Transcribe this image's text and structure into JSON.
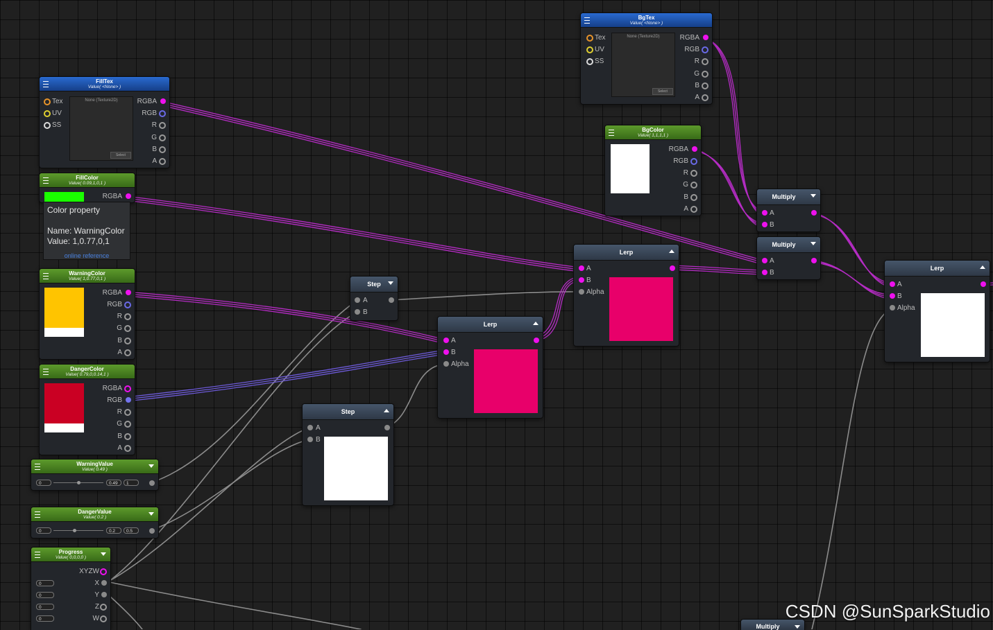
{
  "nodes": {
    "bgtex": {
      "title": "BgTex",
      "subtitle": "Value( <None> )",
      "inputs": [
        "Tex",
        "UV",
        "SS"
      ],
      "outputs": [
        "RGBA",
        "RGB",
        "R",
        "G",
        "B",
        "A"
      ],
      "texture_label": "None (Texture2D)",
      "select_label": "Select"
    },
    "filltex": {
      "title": "FillTex",
      "subtitle": "Value( <None> )",
      "inputs": [
        "Tex",
        "UV",
        "SS"
      ],
      "outputs": [
        "RGBA",
        "RGB",
        "R",
        "G",
        "B",
        "A"
      ],
      "texture_label": "None (Texture2D)",
      "select_label": "Select"
    },
    "bgcolor": {
      "title": "BgColor",
      "subtitle": "Value( 1,1,1,1 )",
      "outputs": [
        "RGBA",
        "RGB",
        "R",
        "G",
        "B",
        "A"
      ],
      "swatch_color": "#ffffff"
    },
    "fillcolor": {
      "title": "FillColor",
      "subtitle": "Value( 0.09,1,0,1 )",
      "outputs": [
        "RGBA"
      ],
      "swatch_color": "#1aff00"
    },
    "warningcolor": {
      "title": "WarningColor",
      "subtitle": "Value( 1,0.77,0,1 )",
      "outputs": [
        "RGBA",
        "RGB",
        "R",
        "G",
        "B",
        "A"
      ],
      "swatch_color": "#ffc400"
    },
    "dangercolor": {
      "title": "DangerColor",
      "subtitle": "Value( 0.79,0,0.14,1 )",
      "outputs": [
        "RGBA",
        "RGB",
        "R",
        "G",
        "B",
        "A"
      ],
      "swatch_color": "#ca0023"
    },
    "warningvalue": {
      "title": "WarningValue",
      "subtitle": "Value( 0.49 )",
      "min": "0",
      "value": "0.49",
      "max": "1",
      "level": 0.49
    },
    "dangervalue": {
      "title": "DangerValue",
      "subtitle": "Value( 0.2 )",
      "min": "0",
      "value": "0.2",
      "max": "0.5",
      "level": 0.4
    },
    "progress": {
      "title": "Progress",
      "subtitle": "Value( 0,0,0,0 )",
      "outputs": [
        "XYZW",
        "X",
        "Y",
        "Z",
        "W"
      ],
      "fields": [
        "0",
        "0",
        "0",
        "0"
      ]
    },
    "step1": {
      "title": "Step",
      "inputs": [
        "A",
        "B"
      ]
    },
    "step2": {
      "title": "Step",
      "inputs": [
        "A",
        "B"
      ],
      "preview_color": "#ffffff"
    },
    "lerp1": {
      "title": "Lerp",
      "inputs": [
        "A",
        "B",
        "Alpha"
      ],
      "preview_color": "#e8006a"
    },
    "lerp2": {
      "title": "Lerp",
      "inputs": [
        "A",
        "B",
        "Alpha"
      ],
      "preview_color": "#e8006a"
    },
    "lerp3": {
      "title": "Lerp",
      "inputs": [
        "A",
        "B",
        "Alpha"
      ],
      "preview_color": "#ffffff"
    },
    "multiply1": {
      "title": "Multiply",
      "inputs": [
        "A",
        "B"
      ]
    },
    "multiply2": {
      "title": "Multiply",
      "inputs": [
        "A",
        "B"
      ]
    },
    "multiply3": {
      "title": "Multiply"
    }
  },
  "tooltip": {
    "heading": "Color property",
    "name_line": "Name: WarningColor",
    "value_line": "Value: 1,0.77,0,1",
    "link": "online reference"
  },
  "watermark": "CSDN @SunSparkStudio",
  "colors": {
    "accent_port": "#ee11ee",
    "vector_port": "#7474ee",
    "wire_color": "#c030c8",
    "wire_grey": "#8a8a8a"
  }
}
